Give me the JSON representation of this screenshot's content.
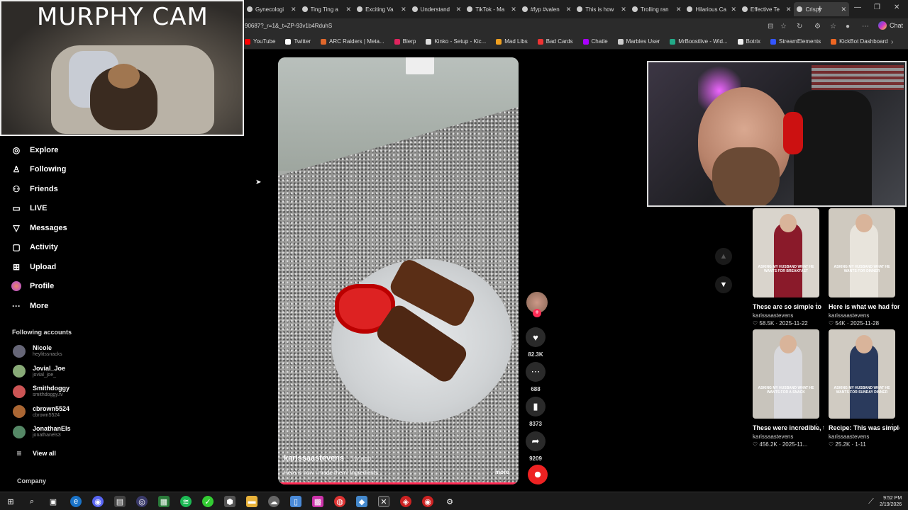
{
  "browser": {
    "tabs": [
      {
        "label": "Gynecologi",
        "active": false
      },
      {
        "label": "Ting Ting a",
        "active": false
      },
      {
        "label": "Exciting Va",
        "active": false
      },
      {
        "label": "Understand",
        "active": false
      },
      {
        "label": "TikTok - Ma",
        "active": false
      },
      {
        "label": "#fyp #valen",
        "active": false
      },
      {
        "label": "This is how",
        "active": false
      },
      {
        "label": "Trolling ran",
        "active": false
      },
      {
        "label": "Hilarious Ca",
        "active": false
      },
      {
        "label": "Effective Te",
        "active": false
      },
      {
        "label": "Crispy",
        "active": true
      }
    ],
    "new_tab": "+",
    "url": "90687?_r=1&_t=ZP-93v1b4RduhS",
    "copilot_label": "Chat",
    "bookmarks": [
      {
        "label": "YouTube",
        "color": "#ff0000"
      },
      {
        "label": "Twitter",
        "color": "#ffffff"
      },
      {
        "label": "ARC Raiders | Meta...",
        "color": "#e0672b"
      },
      {
        "label": "Blerp",
        "color": "#e0245e"
      },
      {
        "label": "Kinko - Setup - Kic...",
        "color": "#dddddd"
      },
      {
        "label": "Mad Libs",
        "color": "#f0a020"
      },
      {
        "label": "Bad Cards",
        "color": "#e33"
      },
      {
        "label": "Chatle",
        "color": "#a0f"
      },
      {
        "label": "Marbles User",
        "color": "#ccc"
      },
      {
        "label": "MrBoostlive - Wid...",
        "color": "#2a8"
      },
      {
        "label": "Botrix",
        "color": "#eee"
      },
      {
        "label": "StreamElements",
        "color": "#3355ff"
      },
      {
        "label": "KickBot Dashboard",
        "color": "#e62"
      }
    ]
  },
  "murphy_cam": {
    "title": "MURPHY CAM"
  },
  "nav": {
    "items": [
      {
        "label": "Explore",
        "icon": "compass-icon",
        "glyph": "◎"
      },
      {
        "label": "Following",
        "icon": "user-follow-icon",
        "glyph": "♙"
      },
      {
        "label": "Friends",
        "icon": "friends-icon",
        "glyph": "⚇"
      },
      {
        "label": "LIVE",
        "icon": "live-icon",
        "glyph": "▭"
      },
      {
        "label": "Messages",
        "icon": "send-icon",
        "glyph": "▽"
      },
      {
        "label": "Activity",
        "icon": "activity-icon",
        "glyph": "▢"
      },
      {
        "label": "Upload",
        "icon": "upload-icon",
        "glyph": "⊞"
      },
      {
        "label": "Profile",
        "icon": "profile-icon",
        "glyph": ""
      },
      {
        "label": "More",
        "icon": "more-icon",
        "glyph": "···"
      }
    ],
    "following_title": "Following accounts",
    "accounts": [
      {
        "name": "Nicole",
        "handle": "heylitssnacks"
      },
      {
        "name": "Jovial_Joe",
        "handle": "jovial_joe_"
      },
      {
        "name": "Smithdoggy",
        "handle": "smithdoggy.tv"
      },
      {
        "name": "cbrown5524",
        "handle": "cbrown5524"
      },
      {
        "name": "JonathanEls",
        "handle": "jonathanels3"
      }
    ],
    "view_all": "View all",
    "company": "Company"
  },
  "video": {
    "author": "karissaastevens",
    "age": "· 1w ago",
    "caption": "Here is how I made them! Ingredients...",
    "more": "more"
  },
  "actions": {
    "likes": "82.3K",
    "comments": "688",
    "saves": "8373",
    "shares": "9209"
  },
  "recommended": [
    {
      "title": "These are so simple to make...",
      "author": "karissaastevens",
      "stats": "♡ 58.5K · 2025-11-22",
      "caption": "ASKING MY HUSBAND WHAT HE WANTS FOR BREAKFAST",
      "shirt": "#8a1a2a"
    },
    {
      "title": "Here is what we had for dinner! B...",
      "author": "karissaastevens",
      "stats": "♡ 54K · 2025-11-28",
      "caption": "ASKING MY HUSBAND WHAT HE WANTS FOR DINNER",
      "shirt": "#e8e4dc"
    },
    {
      "title": "These were incredible, two o...",
      "author": "karissaastevens",
      "stats": "♡ 456.2K · 2025-11...",
      "caption": "ASKING MY HUSBAND WHAT HE WANTS FOR A SNACK",
      "shirt": "#d8d8dc"
    },
    {
      "title": "Recipe: This was simple and easy,...",
      "author": "karissaastevens",
      "stats": "♡ 25.2K · 1-11",
      "caption": "ASKING MY HUSBAND WHAT HE WANTS FOR SUNDAY DINNER",
      "shirt": "#2a3a5c"
    }
  ],
  "taskbar": {
    "time": "9:52 PM",
    "date": "2/19/2026"
  }
}
